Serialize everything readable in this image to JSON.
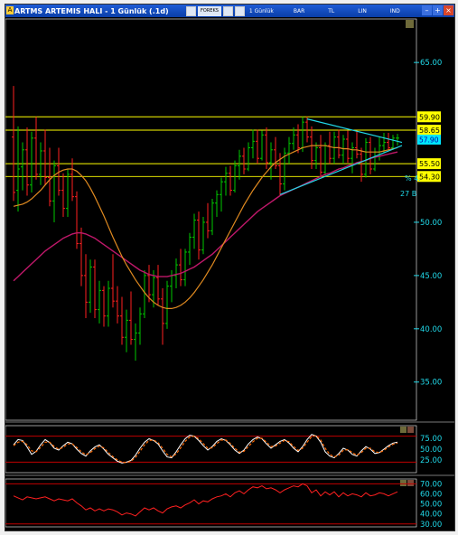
{
  "window": {
    "title": "ARTMS ARTEMIS HALI - 1 Günlük (.1d)",
    "toolbar": [
      "1 Günlük",
      "BAR",
      "TL",
      "LIN",
      "IND"
    ],
    "toolbar_small": "FOREKS"
  },
  "chart_data": [
    {
      "type": "line",
      "panel": "price",
      "ylim": [
        31.5,
        69.0
      ],
      "y_ticks": [
        "65.00",
        "50.00",
        "45.00",
        "40.00",
        "35.00"
      ],
      "tick_values": [
        65,
        50,
        45,
        40,
        35
      ],
      "horizontal_levels": [
        {
          "value": 59.9,
          "label": "59.90"
        },
        {
          "value": 58.65,
          "label": "58.65"
        },
        {
          "value": 55.5,
          "label": "55.50"
        },
        {
          "value": 54.3,
          "label": "54.30"
        }
      ],
      "level_color": "#ffff00",
      "level_label_bg": "#ffff00",
      "current_label": "57.90",
      "bar_count": 86,
      "annotations": [
        "% 4.",
        "27 B"
      ],
      "colors": {
        "up": "#00c800",
        "down": "#ff2020",
        "ma_fast": "#e08a20",
        "ma_slow": "#c0186a",
        "trend": "#20d8e8"
      },
      "bars": [
        [
          58.0,
          62.8,
          52.0,
          52.8
        ],
        [
          53.0,
          59.0,
          51.0,
          55.0
        ],
        [
          55.2,
          57.5,
          53.0,
          56.8
        ],
        [
          56.8,
          58.9,
          52.5,
          53.5
        ],
        [
          53.5,
          58.5,
          52.8,
          57.9
        ],
        [
          57.9,
          59.9,
          54.0,
          54.5
        ],
        [
          54.5,
          57.5,
          53.5,
          56.7
        ],
        [
          56.7,
          58.7,
          53.5,
          54.2
        ],
        [
          54.2,
          57.0,
          51.5,
          52.0
        ],
        [
          52.0,
          55.8,
          50.0,
          55.3
        ],
        [
          55.3,
          57.0,
          52.5,
          53.0
        ],
        [
          53.0,
          54.6,
          50.5,
          51.3
        ],
        [
          51.3,
          55.0,
          50.5,
          54.5
        ],
        [
          54.5,
          56.0,
          52.0,
          52.4
        ],
        [
          52.4,
          52.9,
          47.5,
          48.0
        ],
        [
          48.0,
          49.5,
          44.0,
          45.0
        ],
        [
          45.0,
          47.0,
          41.0,
          42.5
        ],
        [
          42.5,
          46.5,
          41.5,
          45.8
        ],
        [
          45.8,
          46.5,
          41.0,
          41.8
        ],
        [
          41.8,
          44.5,
          40.5,
          43.6
        ],
        [
          43.6,
          44.0,
          40.2,
          41.2
        ],
        [
          41.2,
          44.5,
          40.2,
          43.8
        ],
        [
          43.8,
          47.0,
          42.0,
          42.6
        ],
        [
          42.6,
          44.0,
          40.5,
          41.2
        ],
        [
          41.2,
          43.0,
          38.5,
          39.2
        ],
        [
          39.2,
          41.8,
          37.8,
          40.8
        ],
        [
          40.8,
          43.5,
          38.5,
          39.0
        ],
        [
          39.0,
          40.5,
          37.0,
          39.6
        ],
        [
          39.6,
          42.0,
          38.5,
          41.4
        ],
        [
          41.4,
          45.5,
          41.0,
          45.0
        ],
        [
          45.0,
          46.0,
          42.5,
          43.2
        ],
        [
          43.2,
          45.5,
          42.0,
          44.8
        ],
        [
          44.8,
          46.0,
          42.2,
          42.8
        ],
        [
          42.8,
          43.8,
          38.5,
          40.5
        ],
        [
          40.5,
          44.5,
          40.0,
          44.0
        ],
        [
          44.0,
          45.5,
          42.5,
          45.0
        ],
        [
          45.0,
          46.6,
          43.8,
          46.0
        ],
        [
          46.0,
          47.5,
          44.0,
          44.6
        ],
        [
          44.6,
          47.5,
          44.0,
          47.2
        ],
        [
          47.2,
          49.0,
          46.0,
          48.6
        ],
        [
          48.6,
          50.8,
          47.5,
          50.2
        ],
        [
          50.2,
          51.0,
          46.5,
          47.4
        ],
        [
          47.4,
          50.5,
          47.0,
          50.0
        ],
        [
          50.0,
          51.8,
          48.5,
          49.2
        ],
        [
          49.2,
          52.2,
          48.8,
          51.8
        ],
        [
          51.8,
          53.0,
          50.5,
          52.6
        ],
        [
          52.6,
          54.2,
          51.0,
          53.8
        ],
        [
          53.8,
          55.2,
          52.5,
          54.6
        ],
        [
          54.6,
          55.3,
          52.5,
          53.0
        ],
        [
          53.0,
          55.8,
          52.8,
          55.3
        ],
        [
          55.3,
          56.8,
          54.0,
          56.2
        ],
        [
          56.2,
          57.0,
          54.5,
          55.0
        ],
        [
          55.0,
          57.5,
          54.8,
          57.0
        ],
        [
          57.0,
          58.7,
          56.0,
          57.6
        ],
        [
          57.6,
          58.7,
          55.5,
          56.0
        ],
        [
          56.0,
          58.6,
          55.8,
          58.2
        ],
        [
          58.2,
          58.9,
          55.0,
          55.6
        ],
        [
          55.6,
          57.5,
          54.0,
          56.8
        ],
        [
          56.8,
          58.0,
          55.0,
          55.3
        ],
        [
          55.3,
          56.5,
          52.5,
          53.6
        ],
        [
          53.6,
          57.0,
          53.0,
          56.5
        ],
        [
          56.5,
          58.0,
          55.5,
          57.4
        ],
        [
          57.4,
          58.9,
          56.8,
          58.2
        ],
        [
          58.2,
          59.2,
          56.5,
          57.0
        ],
        [
          57.0,
          59.9,
          56.6,
          59.4
        ],
        [
          59.4,
          59.9,
          57.5,
          58.0
        ],
        [
          58.0,
          59.0,
          55.0,
          55.8
        ],
        [
          55.8,
          57.5,
          55.0,
          57.0
        ],
        [
          57.0,
          58.2,
          54.2,
          54.7
        ],
        [
          54.7,
          57.5,
          54.3,
          57.2
        ],
        [
          57.2,
          58.5,
          55.5,
          56.0
        ],
        [
          56.0,
          58.5,
          55.5,
          58.0
        ],
        [
          58.0,
          58.7,
          56.0,
          56.3
        ],
        [
          56.3,
          58.2,
          55.5,
          57.8
        ],
        [
          57.8,
          58.6,
          55.6,
          56.0
        ],
        [
          56.0,
          57.5,
          54.6,
          57.0
        ],
        [
          57.0,
          58.6,
          56.0,
          56.4
        ],
        [
          56.4,
          57.0,
          53.8,
          54.5
        ],
        [
          54.5,
          57.9,
          54.2,
          57.5
        ],
        [
          57.5,
          58.0,
          54.5,
          55.0
        ],
        [
          55.0,
          57.0,
          54.8,
          56.6
        ],
        [
          56.6,
          58.0,
          55.8,
          57.2
        ],
        [
          57.2,
          58.4,
          56.5,
          57.5
        ],
        [
          57.5,
          58.4,
          56.8,
          57.0
        ],
        [
          57.0,
          58.2,
          56.8,
          57.9
        ],
        [
          57.9,
          58.3,
          57.2,
          57.9
        ]
      ],
      "ma_fast": [
        51.5,
        51.6,
        51.7,
        51.9,
        52.2,
        52.6,
        53.0,
        53.5,
        54.0,
        54.4,
        54.7,
        54.9,
        55.0,
        55.0,
        54.8,
        54.4,
        53.9,
        53.2,
        52.4,
        51.5,
        50.6,
        49.6,
        48.6,
        47.7,
        46.8,
        46.0,
        45.3,
        44.6,
        44.0,
        43.4,
        42.9,
        42.5,
        42.2,
        42.0,
        41.9,
        41.9,
        42.0,
        42.2,
        42.5,
        42.9,
        43.4,
        44.0,
        44.6,
        45.3,
        46.0,
        46.8,
        47.6,
        48.4,
        49.2,
        50.0,
        50.8,
        51.6,
        52.3,
        53.0,
        53.6,
        54.2,
        54.7,
        55.2,
        55.6,
        55.9,
        56.2,
        56.4,
        56.6,
        56.8,
        57.0,
        57.1,
        57.2,
        57.2,
        57.2,
        57.2,
        57.1,
        57.0,
        57.0,
        56.9,
        56.9,
        56.8,
        56.8,
        56.7,
        56.6,
        56.6,
        56.6,
        56.6,
        56.7,
        56.8,
        56.9,
        57.0
      ],
      "ma_slow": [
        44.5,
        44.9,
        45.3,
        45.7,
        46.1,
        46.5,
        46.9,
        47.3,
        47.6,
        47.9,
        48.2,
        48.5,
        48.7,
        48.9,
        49.0,
        49.0,
        48.9,
        48.7,
        48.5,
        48.2,
        47.9,
        47.6,
        47.3,
        47.0,
        46.7,
        46.4,
        46.1,
        45.8,
        45.5,
        45.3,
        45.1,
        45.0,
        44.9,
        44.9,
        44.9,
        45.0,
        45.1,
        45.2,
        45.4,
        45.6,
        45.8,
        46.1,
        46.4,
        46.7,
        47.0,
        47.4,
        47.8,
        48.2,
        48.6,
        49.0,
        49.4,
        49.8,
        50.2,
        50.6,
        51.0,
        51.3,
        51.6,
        51.9,
        52.2,
        52.5,
        52.7,
        52.9,
        53.1,
        53.3,
        53.5,
        53.7,
        53.9,
        54.1,
        54.3,
        54.5,
        54.6,
        54.8,
        55.0,
        55.1,
        55.3,
        55.4,
        55.6,
        55.7,
        55.8,
        56.0,
        56.1,
        56.2,
        56.3,
        56.4,
        56.5,
        56.6
      ],
      "trend_lines": [
        {
          "x1": 65,
          "y1": 59.7,
          "x2": 86,
          "y2": 57.5
        },
        {
          "x1": 59,
          "y1": 52.6,
          "x2": 86,
          "y2": 57.2
        }
      ]
    },
    {
      "type": "line",
      "panel": "oscillator",
      "ylim": [
        0,
        100
      ],
      "y_ticks": [
        "75.00",
        "50.00",
        "25.00"
      ],
      "tick_values": [
        75,
        50,
        25
      ],
      "levels": [
        80,
        20
      ],
      "colors": {
        "fast": "#ffffff",
        "slow": "#ff6a00",
        "level": "#c00000"
      },
      "series_fast": [
        60,
        72,
        70,
        55,
        38,
        45,
        60,
        72,
        65,
        52,
        48,
        58,
        66,
        62,
        50,
        40,
        34,
        46,
        55,
        60,
        50,
        38,
        30,
        22,
        18,
        20,
        24,
        36,
        52,
        66,
        74,
        70,
        62,
        46,
        32,
        30,
        44,
        60,
        74,
        82,
        80,
        70,
        58,
        48,
        56,
        68,
        74,
        70,
        60,
        48,
        40,
        48,
        62,
        72,
        78,
        74,
        62,
        52,
        60,
        68,
        72,
        64,
        52,
        44,
        56,
        72,
        84,
        80,
        66,
        44,
        34,
        30,
        40,
        52,
        48,
        38,
        34,
        46,
        56,
        50,
        40,
        42,
        50,
        58,
        64,
        66
      ],
      "series_slow": [
        58,
        66,
        68,
        60,
        46,
        44,
        54,
        66,
        66,
        56,
        50,
        54,
        62,
        62,
        54,
        44,
        37,
        42,
        51,
        57,
        53,
        42,
        33,
        25,
        20,
        19,
        22,
        31,
        45,
        60,
        70,
        71,
        65,
        52,
        38,
        32,
        39,
        53,
        68,
        78,
        80,
        74,
        63,
        52,
        53,
        63,
        71,
        71,
        63,
        52,
        43,
        45,
        56,
        67,
        75,
        75,
        66,
        56,
        57,
        64,
        70,
        67,
        56,
        47,
        52,
        66,
        79,
        81,
        71,
        52,
        38,
        32,
        36,
        47,
        49,
        42,
        36,
        42,
        52,
        52,
        44,
        42,
        47,
        55,
        61,
        64
      ]
    },
    {
      "type": "line",
      "panel": "indicator",
      "ylim": [
        28,
        73
      ],
      "y_ticks": [
        "70.00",
        "60.00",
        "50.00",
        "40.00",
        "30.00"
      ],
      "tick_values": [
        70,
        60,
        50,
        40,
        30
      ],
      "levels": [
        70,
        30
      ],
      "colors": {
        "line": "#ff2020",
        "level": "#c00000"
      },
      "values": [
        58,
        56,
        54,
        57,
        56,
        55,
        56,
        57,
        55,
        53,
        55,
        54,
        53,
        55,
        51,
        48,
        44,
        46,
        43,
        45,
        43,
        45,
        44,
        42,
        39,
        41,
        40,
        38,
        42,
        46,
        44,
        46,
        43,
        41,
        45,
        47,
        48,
        46,
        49,
        51,
        54,
        50,
        53,
        52,
        55,
        57,
        58,
        60,
        57,
        61,
        63,
        60,
        64,
        67,
        66,
        68,
        65,
        66,
        64,
        61,
        64,
        66,
        68,
        67,
        70,
        68,
        61,
        64,
        58,
        62,
        59,
        62,
        57,
        61,
        58,
        60,
        59,
        57,
        61,
        58,
        59,
        61,
        60,
        58,
        60,
        62
      ]
    }
  ]
}
